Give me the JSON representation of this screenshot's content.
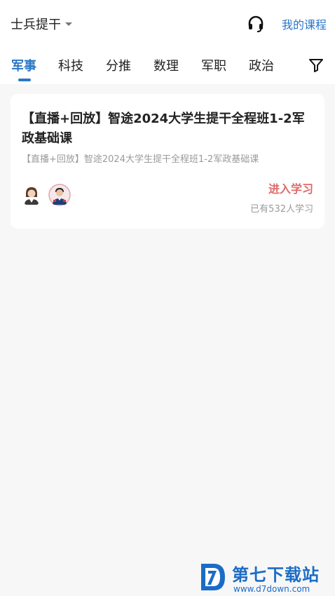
{
  "header": {
    "category": "士兵提干",
    "my_courses": "我的课程"
  },
  "tabs": [
    {
      "label": "军事",
      "active": true
    },
    {
      "label": "科技",
      "active": false
    },
    {
      "label": "分推",
      "active": false
    },
    {
      "label": "数理",
      "active": false
    },
    {
      "label": "军职",
      "active": false
    },
    {
      "label": "政治",
      "active": false
    }
  ],
  "course": {
    "title": "【直播+回放】智途2024大学生提干全程班1-2军政基础课",
    "subtitle": "【直播+回放】智途2024大学生提干全程班1-2军政基础课",
    "enter": "进入学习",
    "learners": "已有532人学习"
  },
  "watermark": {
    "name": "第七下载站",
    "url": "www.d7down.com"
  },
  "colors": {
    "accent": "#2a76c6",
    "enter": "#e06a6a",
    "background": "#f7f7f8"
  },
  "icons": [
    "chevron-down-icon",
    "headset-icon",
    "filter-icon",
    "teacher-avatar",
    "teacher-avatar"
  ]
}
